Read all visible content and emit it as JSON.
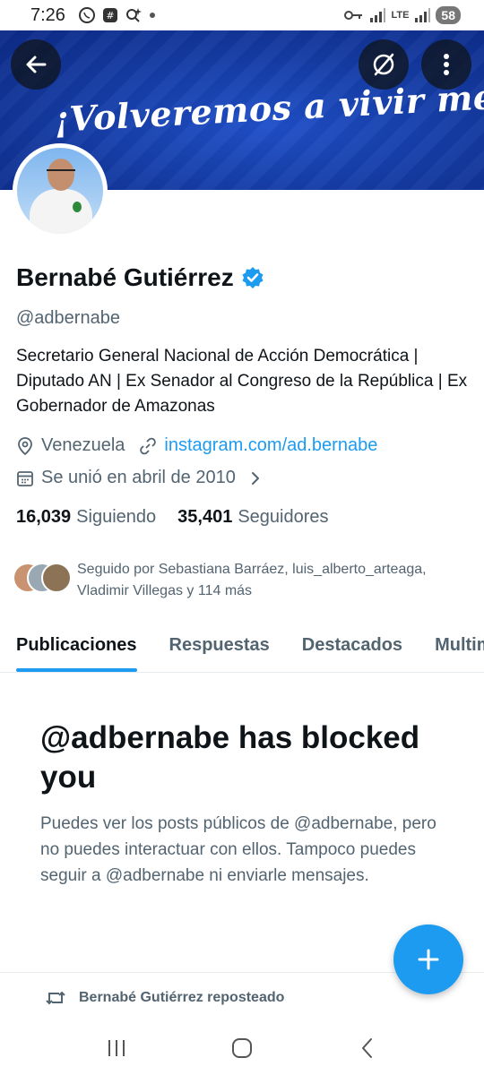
{
  "status_bar": {
    "time": "7:26",
    "network": "LTE",
    "battery": "58"
  },
  "banner": {
    "slogan": "¡Volveremos a vivir mejor!"
  },
  "profile": {
    "name": "Bernabé Gutiérrez",
    "handle": "@adbernabe",
    "bio": "Secretario General Nacional de Acción Democrática | Diputado AN | Ex Senador al Congreso de la República | Ex Gobernador de Amazonas",
    "location": "Venezuela",
    "website": "instagram.com/ad.bernabe",
    "joined": "Se unió en abril de 2010",
    "following_count": "16,039",
    "following_label": "Siguiendo",
    "followers_count": "35,401",
    "followers_label": "Seguidores",
    "followed_by": "Seguido por Sebastiana Barráez, luis_alberto_arteaga, Vladimir Villegas y 114 más"
  },
  "tabs": [
    {
      "label": "Publicaciones",
      "active": true
    },
    {
      "label": "Respuestas",
      "active": false
    },
    {
      "label": "Destacados",
      "active": false
    },
    {
      "label": "Multimedia",
      "active": false
    }
  ],
  "blocked": {
    "title": "@adbernabe has blocked you",
    "description": "Puedes ver los posts públicos de @adbernabe, pero no puedes interactuar con ellos. Tampoco puedes seguir a @adbernabe ni enviarle mensajes."
  },
  "repost": {
    "label": "Bernabé Gutiérrez reposteado"
  },
  "colors": {
    "accent": "#1d9bf0",
    "banner": "#163ea8",
    "secondary_text": "#536471"
  }
}
